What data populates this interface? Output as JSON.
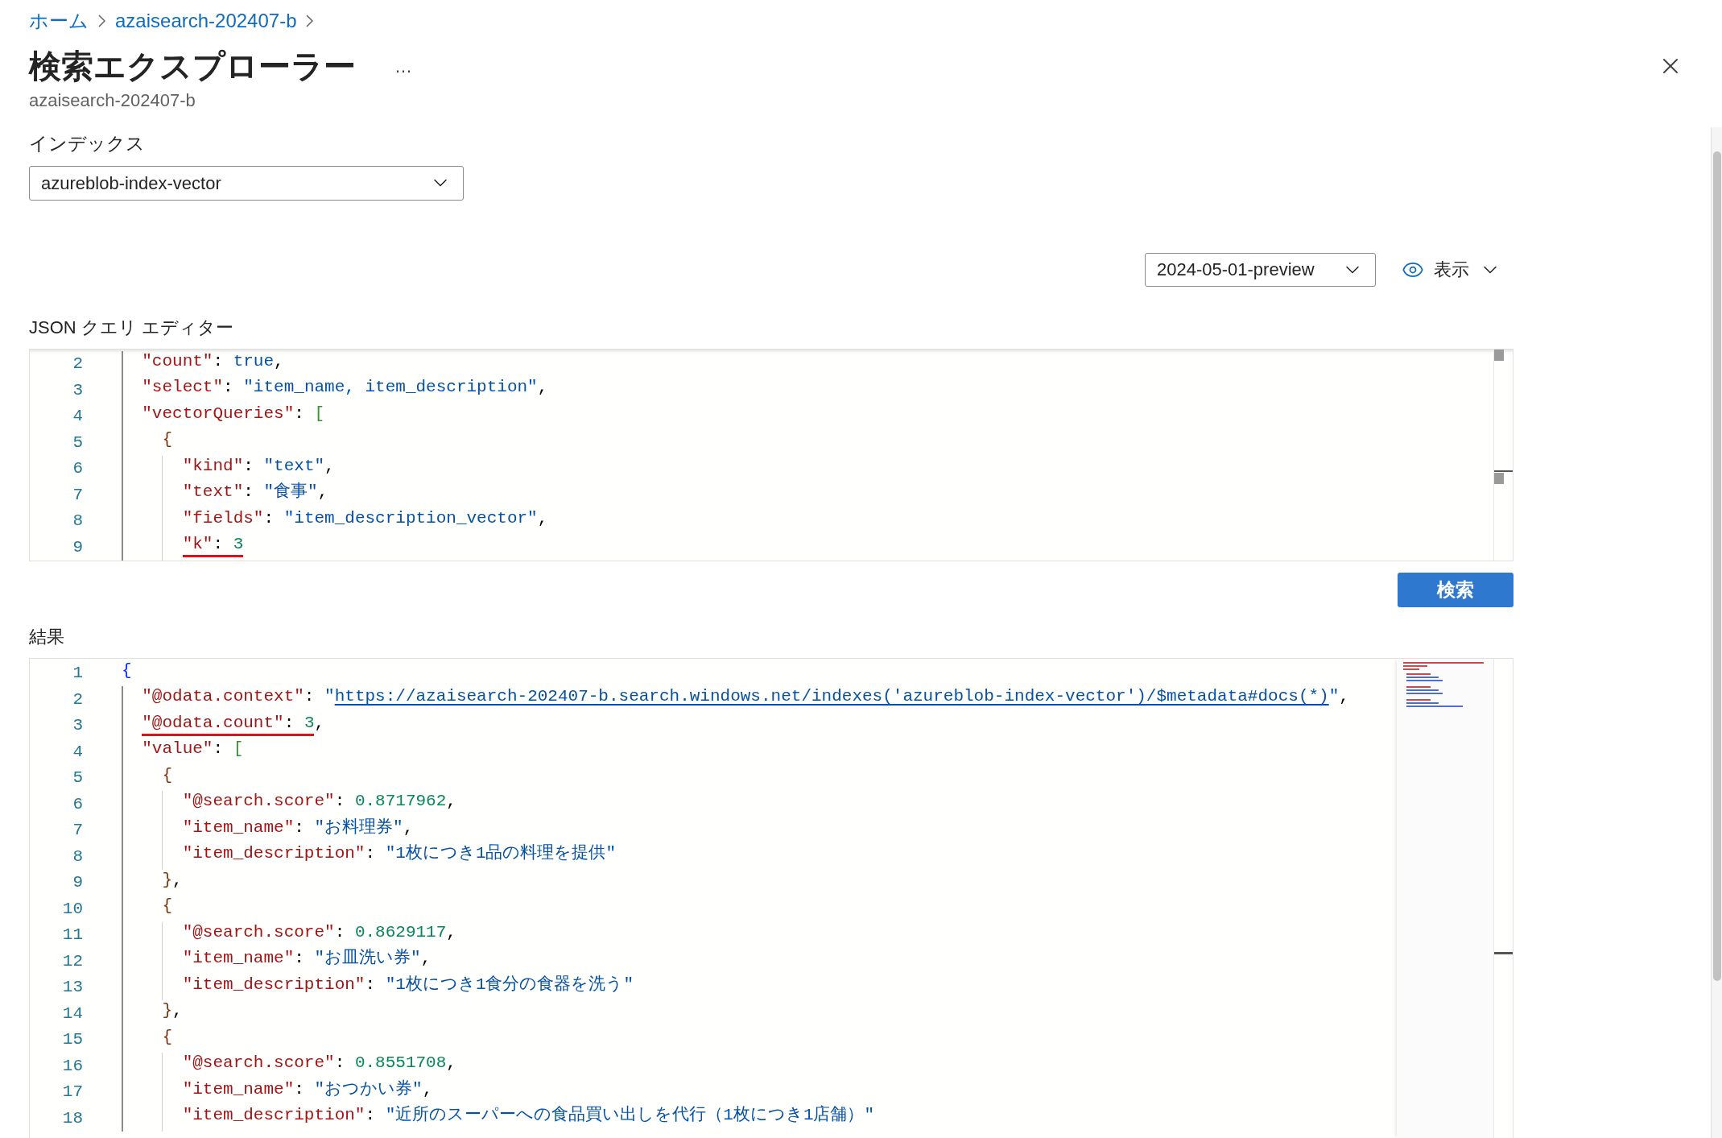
{
  "breadcrumb": [
    {
      "label": "ホーム"
    },
    {
      "label": "azaisearch-202407-b"
    }
  ],
  "title": "検索エクスプローラー",
  "more": "…",
  "subtitle": "azaisearch-202407-b",
  "index": {
    "label": "インデックス",
    "value": "azureblob-index-vector"
  },
  "api_version": {
    "value": "2024-05-01-preview"
  },
  "view": {
    "label": "表示"
  },
  "query_editor": {
    "label": "JSON クエリ エディター",
    "lines": [
      {
        "num": "2",
        "marked": false,
        "tokens": [
          {
            "kind": "key",
            "text": "  \"count\""
          },
          {
            "kind": "punct",
            "text": ": "
          },
          {
            "kind": "str",
            "text": "true"
          },
          {
            "kind": "punct",
            "text": ","
          }
        ]
      },
      {
        "num": "3",
        "marked": false,
        "tokens": [
          {
            "kind": "key",
            "text": "  \"select\""
          },
          {
            "kind": "punct",
            "text": ": "
          },
          {
            "kind": "str",
            "text": "\"item_name, item_description\""
          },
          {
            "kind": "punct",
            "text": ","
          }
        ]
      },
      {
        "num": "4",
        "marked": false,
        "tokens": [
          {
            "kind": "key",
            "text": "  \"vectorQueries\""
          },
          {
            "kind": "punct",
            "text": ": "
          },
          {
            "kind": "bracket",
            "text": "["
          }
        ]
      },
      {
        "num": "5",
        "marked": false,
        "tokens": [
          {
            "kind": "brace2",
            "text": "    {"
          }
        ]
      },
      {
        "num": "6",
        "marked": false,
        "tokens": [
          {
            "kind": "key",
            "text": "      \"kind\""
          },
          {
            "kind": "punct",
            "text": ": "
          },
          {
            "kind": "str",
            "text": "\"text\""
          },
          {
            "kind": "punct",
            "text": ","
          }
        ]
      },
      {
        "num": "7",
        "marked": false,
        "tokens": [
          {
            "kind": "key",
            "text": "      \"text\""
          },
          {
            "kind": "punct",
            "text": ": "
          },
          {
            "kind": "str",
            "text": "\"食事\""
          },
          {
            "kind": "punct",
            "text": ","
          }
        ]
      },
      {
        "num": "8",
        "marked": false,
        "tokens": [
          {
            "kind": "key",
            "text": "      \"fields\""
          },
          {
            "kind": "punct",
            "text": ": "
          },
          {
            "kind": "str",
            "text": "\"item_description_vector\""
          },
          {
            "kind": "punct",
            "text": ","
          }
        ]
      },
      {
        "num": "9",
        "marked": true,
        "tokens": [
          {
            "kind": "key",
            "text": "      \"k\""
          },
          {
            "kind": "punct",
            "text": ": "
          },
          {
            "kind": "num",
            "text": "3"
          }
        ]
      }
    ]
  },
  "search_button": "検索",
  "results": {
    "label": "結果",
    "lines": [
      {
        "num": "1",
        "marked": false,
        "tokens": [
          {
            "kind": "brace1",
            "text": "{"
          }
        ]
      },
      {
        "num": "2",
        "marked": false,
        "tokens": [
          {
            "kind": "key",
            "text": "  \"@odata.context\""
          },
          {
            "kind": "punct",
            "text": ": "
          },
          {
            "kind": "str",
            "text": "\""
          },
          {
            "kind": "link",
            "text": "https://azaisearch-202407-b.search.windows.net/indexes('azureblob-index-vector')/$metadata#docs(*)"
          },
          {
            "kind": "str",
            "text": "\""
          },
          {
            "kind": "punct",
            "text": ","
          }
        ]
      },
      {
        "num": "3",
        "marked": true,
        "tokens": [
          {
            "kind": "key",
            "text": "  \"@odata.count\""
          },
          {
            "kind": "punct",
            "text": ": "
          },
          {
            "kind": "num",
            "text": "3"
          },
          {
            "kind": "punct",
            "text": ","
          }
        ]
      },
      {
        "num": "4",
        "marked": false,
        "tokens": [
          {
            "kind": "key",
            "text": "  \"value\""
          },
          {
            "kind": "punct",
            "text": ": "
          },
          {
            "kind": "bracket",
            "text": "["
          }
        ]
      },
      {
        "num": "5",
        "marked": false,
        "tokens": [
          {
            "kind": "brace2",
            "text": "    {"
          }
        ]
      },
      {
        "num": "6",
        "marked": false,
        "tokens": [
          {
            "kind": "key",
            "text": "      \"@search.score\""
          },
          {
            "kind": "punct",
            "text": ": "
          },
          {
            "kind": "num",
            "text": "0.8717962"
          },
          {
            "kind": "punct",
            "text": ","
          }
        ]
      },
      {
        "num": "7",
        "marked": false,
        "tokens": [
          {
            "kind": "key",
            "text": "      \"item_name\""
          },
          {
            "kind": "punct",
            "text": ": "
          },
          {
            "kind": "str",
            "text": "\"お料理券\""
          },
          {
            "kind": "punct",
            "text": ","
          }
        ]
      },
      {
        "num": "8",
        "marked": false,
        "tokens": [
          {
            "kind": "key",
            "text": "      \"item_description\""
          },
          {
            "kind": "punct",
            "text": ": "
          },
          {
            "kind": "str",
            "text": "\"1枚につき1品の料理を提供\""
          }
        ]
      },
      {
        "num": "9",
        "marked": false,
        "tokens": [
          {
            "kind": "brace2",
            "text": "    }"
          },
          {
            "kind": "punct",
            "text": ","
          }
        ]
      },
      {
        "num": "10",
        "marked": false,
        "tokens": [
          {
            "kind": "brace2",
            "text": "    {"
          }
        ]
      },
      {
        "num": "11",
        "marked": false,
        "tokens": [
          {
            "kind": "key",
            "text": "      \"@search.score\""
          },
          {
            "kind": "punct",
            "text": ": "
          },
          {
            "kind": "num",
            "text": "0.8629117"
          },
          {
            "kind": "punct",
            "text": ","
          }
        ]
      },
      {
        "num": "12",
        "marked": false,
        "tokens": [
          {
            "kind": "key",
            "text": "      \"item_name\""
          },
          {
            "kind": "punct",
            "text": ": "
          },
          {
            "kind": "str",
            "text": "\"お皿洗い券\""
          },
          {
            "kind": "punct",
            "text": ","
          }
        ]
      },
      {
        "num": "13",
        "marked": false,
        "tokens": [
          {
            "kind": "key",
            "text": "      \"item_description\""
          },
          {
            "kind": "punct",
            "text": ": "
          },
          {
            "kind": "str",
            "text": "\"1枚につき1食分の食器を洗う\""
          }
        ]
      },
      {
        "num": "14",
        "marked": false,
        "tokens": [
          {
            "kind": "brace2",
            "text": "    }"
          },
          {
            "kind": "punct",
            "text": ","
          }
        ]
      },
      {
        "num": "15",
        "marked": false,
        "tokens": [
          {
            "kind": "brace2",
            "text": "    {"
          }
        ]
      },
      {
        "num": "16",
        "marked": false,
        "tokens": [
          {
            "kind": "key",
            "text": "      \"@search.score\""
          },
          {
            "kind": "punct",
            "text": ": "
          },
          {
            "kind": "num",
            "text": "0.8551708"
          },
          {
            "kind": "punct",
            "text": ","
          }
        ]
      },
      {
        "num": "17",
        "marked": false,
        "tokens": [
          {
            "kind": "key",
            "text": "      \"item_name\""
          },
          {
            "kind": "punct",
            "text": ": "
          },
          {
            "kind": "str",
            "text": "\"おつかい券\""
          },
          {
            "kind": "punct",
            "text": ","
          }
        ]
      },
      {
        "num": "18",
        "marked": false,
        "tokens": [
          {
            "kind": "key",
            "text": "      \"item_description\""
          },
          {
            "kind": "punct",
            "text": ": "
          },
          {
            "kind": "str",
            "text": "\"近所のスーパーへの食品買い出しを代行（1枚につき1店舗）\""
          }
        ]
      }
    ]
  }
}
